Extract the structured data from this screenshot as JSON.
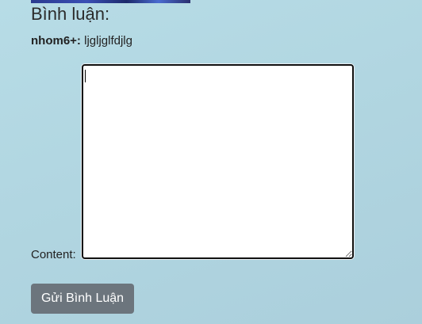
{
  "section": {
    "heading": "Bình luận:"
  },
  "comments": [
    {
      "author": "nhom6+:",
      "text": "ljgljglfdjlg"
    }
  ],
  "form": {
    "content_label": "Content:",
    "content_value": "",
    "submit_label": "Gửi Bình Luận"
  },
  "colors": {
    "background": "#b1d6e1",
    "button": "#6c757d",
    "button_text": "#ffffff"
  }
}
